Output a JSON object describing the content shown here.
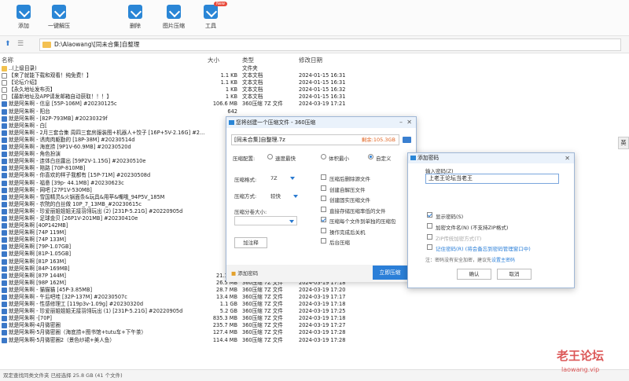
{
  "toolbar": {
    "items": [
      {
        "label": "添加",
        "icon": "add-icon"
      },
      {
        "label": "一键解压",
        "icon": "extract-icon"
      },
      {
        "label": "删除",
        "icon": "delete-icon"
      },
      {
        "label": "图片压缩",
        "icon": "image-compress-icon"
      },
      {
        "label": "工具",
        "icon": "tools-icon",
        "badge": "New"
      }
    ]
  },
  "address": {
    "path": "D:\\Alaowang\\[同未合集]自整理"
  },
  "columns": {
    "name": "名称",
    "size": "大小",
    "type": "类型",
    "date": "修改日期"
  },
  "files": [
    {
      "name": "..(上级目录)",
      "size": "",
      "type": "文件夹",
      "date": "",
      "kind": "up"
    },
    {
      "name": "【来了就能下载和观看！纯免费！】",
      "size": "1.1 KB",
      "type": "文本文档",
      "date": "2024-01-15 16:31",
      "kind": "txt"
    },
    {
      "name": "【论坛介绍】",
      "size": "1.1 KB",
      "type": "文本文档",
      "date": "2024-01-15 16:31",
      "kind": "txt"
    },
    {
      "name": "【永久地址发布页】",
      "size": "1 KB",
      "type": "文本文档",
      "date": "2024-01-15 16:32",
      "kind": "txt"
    },
    {
      "name": "【最新地址及APP请发邮箱自动获取！！！】",
      "size": "1 KB",
      "type": "文本文档",
      "date": "2024-01-15 16:31",
      "kind": "txt"
    },
    {
      "name": "就是阿朱啊 - 信息 [55P-106M] #20230125c",
      "size": "106.6 MB",
      "type": "360压缩 7Z 文件",
      "date": "2024-03-19 17:21",
      "kind": "7z"
    },
    {
      "name": "就是阿朱啊 - 阳台",
      "size": "642",
      "type": "",
      "date": "",
      "kind": "7z"
    },
    {
      "name": "就是阿朱啊 - [82P-793MB] #20230329f",
      "size": "787",
      "type": "",
      "date": "",
      "kind": "7z"
    },
    {
      "name": "就是阿朱啊 - 白[",
      "size": "",
      "type": "",
      "date": "",
      "kind": "7z"
    },
    {
      "name": "就是阿朱啊 - 2月三套合集 周四三套房服装图+机器人+饺子 [16P+5V-2.16G] #2...",
      "size": "2",
      "type": "",
      "date": "",
      "kind": "7z"
    },
    {
      "name": "就是阿朱啊 - 诱肉肉躯勤的 [18P-38M] #20230514d",
      "size": "38",
      "type": "",
      "date": "",
      "kind": "7z"
    },
    {
      "name": "就是阿朱啊 - 海底捞 [9P1V-60.9MB] #20230520d",
      "size": "60",
      "type": "",
      "date": "",
      "kind": "7z"
    },
    {
      "name": "就是阿朱啊 - 角色扮演",
      "size": "",
      "type": "",
      "date": "",
      "kind": "7z"
    },
    {
      "name": "就是阿朱啊 - 连体白丝露出 [59P2V-1.15G] #20230510e",
      "size": "1",
      "type": "",
      "date": "",
      "kind": "7z"
    },
    {
      "name": "就是阿朱啊 - 陪路 [70P-810MB]",
      "size": "790",
      "type": "",
      "date": "",
      "kind": "7z"
    },
    {
      "name": "就是阿朱啊 - 你喜欢的样子我都有 [15P-71M] #20230508d",
      "size": "70",
      "type": "",
      "date": "",
      "kind": "7z"
    },
    {
      "name": "就是阿朱啊 - 福意 [39p- 44.1MB] #20230623c",
      "size": "43",
      "type": "",
      "date": "",
      "kind": "7z"
    },
    {
      "name": "就是阿朱啊 - 网吧 [27P1V-530MB]",
      "size": "530",
      "type": "",
      "date": "",
      "kind": "7z"
    },
    {
      "name": "就是阿朱啊 - 雪国精灵&火锅面条&玩具&用苹&嘴哦_94P5V_185M",
      "size": "185",
      "type": "",
      "date": "",
      "kind": "7z"
    },
    {
      "name": "就是阿朱啊 - 农院的白丝做 10P_7_13MB_#20230615c",
      "size": "7",
      "type": "",
      "date": "",
      "kind": "7z"
    },
    {
      "name": "就是阿朱啊 - 珍爱丽姐姐姐无接羽翎玩出 (2) [231P-5.21G] #20220905d",
      "size": "5",
      "type": "",
      "date": "",
      "kind": "7z"
    },
    {
      "name": "就是阿朱啊 - 足球金贝 [26P1V-201MB] #20230410e",
      "size": "201",
      "type": "",
      "date": "",
      "kind": "7z"
    },
    {
      "name": "就是阿朱啊 [40P142MB]",
      "size": "138",
      "type": "",
      "date": "",
      "kind": "7z"
    },
    {
      "name": "就是阿朱啊 [74P 119M]",
      "size": "118",
      "type": "",
      "date": "",
      "kind": "7z"
    },
    {
      "name": "就是阿朱啊 [74P 133M]",
      "size": "132",
      "type": "",
      "date": "",
      "kind": "7z"
    },
    {
      "name": "就是阿朱啊 [79P-1.07GB]",
      "size": "1",
      "type": "",
      "date": "",
      "kind": "7z"
    },
    {
      "name": "就是阿朱啊 [81P-1.05GB]",
      "size": "1",
      "type": "",
      "date": "",
      "kind": "7z"
    },
    {
      "name": "就是阿朱啊 [81P 163M]",
      "size": "162",
      "type": "",
      "date": "",
      "kind": "7z"
    },
    {
      "name": "就是阿朱啊 [84P-169MB]",
      "size": "138",
      "type": "",
      "date": "",
      "kind": "7z"
    },
    {
      "name": "就是阿朱啊 [87P 144M]",
      "size": "21.1 MB",
      "type": "360压缩 7Z 文件",
      "date": "2024-03-19 17:18",
      "kind": "7z"
    },
    {
      "name": "就是阿朱啊 [98P 162M]",
      "size": "26.5 MB",
      "type": "360压缩 7Z 文件",
      "date": "2024-03-19 17:18",
      "kind": "7z"
    },
    {
      "name": "就是阿朱啊 - 猫猫猫 [45P-3.85MB]",
      "size": "28.7 MB",
      "type": "360压缩 7Z 文件",
      "date": "2024-03-19 17:20",
      "kind": "7z"
    },
    {
      "name": "就是阿朱啊 - 午后吧哇 [32P-137M] #20230507c",
      "size": "13.4 MB",
      "type": "360压缩 7Z 文件",
      "date": "2024-03-19 17:17",
      "kind": "7z"
    },
    {
      "name": "就是阿朱啊 - 性感修理工 [119p3v-1.09g] #20230320d",
      "size": "1.1 GB",
      "type": "360压缩 7Z 文件",
      "date": "2024-03-19 17:18",
      "kind": "7z"
    },
    {
      "name": "就是阿朱啊 - 珍爱丽姐姐姐无接羽翎玩出 (1) [231P-5.21G] #20220905d",
      "size": "5.2 GB",
      "type": "360压缩 7Z 文件",
      "date": "2024-03-19 17:25",
      "kind": "7z"
    },
    {
      "name": "就是阿朱啊 -[70P]",
      "size": "835.3 MB",
      "type": "360压缩 7Z 文件",
      "date": "2024-03-19 17:18",
      "kind": "7z"
    },
    {
      "name": "就是阿朱啊-4月微密圈",
      "size": "235.7 MB",
      "type": "360压缩 7Z 文件",
      "date": "2024-03-19 17:27",
      "kind": "7z"
    },
    {
      "name": "就是阿朱啊-5月微密圈（海底捞+图书馆+tutu车+下午茶）",
      "size": "127.4 MB",
      "type": "360压缩 7Z 文件",
      "date": "2024-03-19 17:28",
      "kind": "7z"
    },
    {
      "name": "就是阿朱啊-5月微密圈2（景色纱裙+美人鱼）",
      "size": "114.4 MB",
      "type": "360压缩 7Z 文件",
      "date": "2024-03-19 17:28",
      "kind": "7z"
    }
  ],
  "status": "双定查找同类文件夹 已经选择 25.8 GB (41 个文件)",
  "side_tab": "英",
  "compress_dialog": {
    "title": "您将创建一个压缩文件 - 360压缩",
    "filename": "[同未合集]自整理.7z",
    "size_note": "剩余:105.3GB",
    "config_label": "压缩配置:",
    "modes": [
      "速度最快",
      "体积最小",
      "自定义"
    ],
    "format_label": "压缩格式:",
    "format_value": "7Z",
    "method_label": "压缩方式:",
    "method_value": "较快",
    "split_label": "压缩分卷大小:",
    "encrypt_btn": "加注释",
    "options": [
      {
        "label": "压缩后删除源文件",
        "checked": false
      },
      {
        "label": "创建自解压文件",
        "checked": false
      },
      {
        "label": "创建固实压缩文件",
        "checked": false
      },
      {
        "label": "直接存储压缩率低的文件",
        "checked": false
      },
      {
        "label": "压缩每个文件到单独的压缩包",
        "checked": true
      },
      {
        "label": "操作完成后关机",
        "checked": false
      },
      {
        "label": "后台压缩",
        "checked": false
      }
    ],
    "add_password": "添加密码",
    "start_btn": "立即压缩"
  },
  "password_dialog": {
    "title": "添加密码",
    "input_label": "输入密码(Z)",
    "password_value": "上老王论坛当老王",
    "options": [
      {
        "label": "显示密码(S)",
        "checked": true
      },
      {
        "label": "加密文件名(N) (不支持ZIP格式)",
        "checked": false
      },
      {
        "label": "ZIP传统加密方式(T)",
        "checked": false
      },
      {
        "label": "记住密码(R) (将会备忘到密码管理窗口中)",
        "checked": false
      }
    ],
    "tip_prefix": "注：密码没有安全加密，建议先",
    "tip_link": "设置主密码",
    "ok": "确认",
    "cancel": "取消"
  },
  "watermark": {
    "line1": "老王论坛",
    "line2": "laowang.vip"
  }
}
